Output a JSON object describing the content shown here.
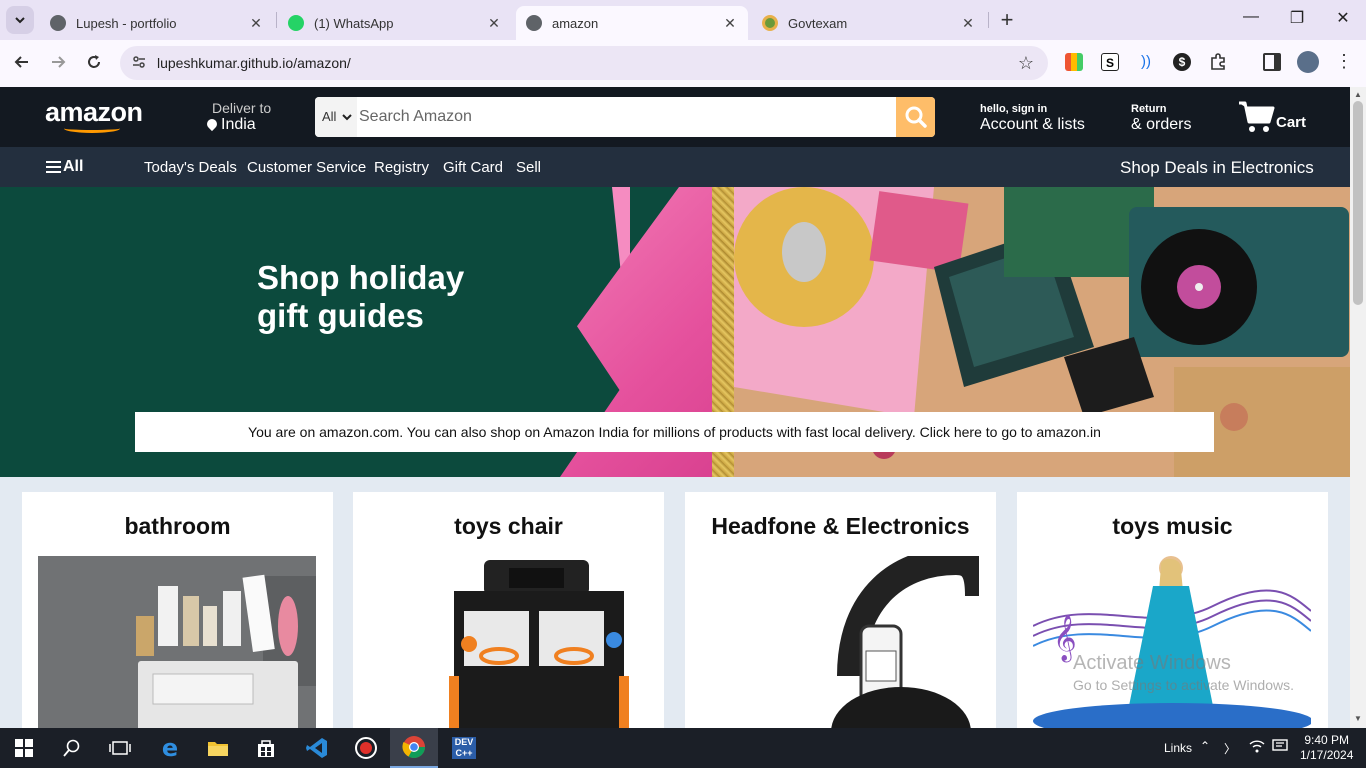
{
  "browser": {
    "tabs": [
      {
        "title": "Lupesh - portfolio",
        "active": false,
        "favicon": "globe-icon"
      },
      {
        "title": "(1) WhatsApp",
        "active": false,
        "favicon": "whatsapp-icon"
      },
      {
        "title": "amazon",
        "active": true,
        "favicon": "globe-icon"
      },
      {
        "title": "Govtexam",
        "active": false,
        "favicon": "govtexam-icon"
      }
    ],
    "url": "lupeshkumar.github.io/amazon/"
  },
  "header": {
    "logo": "amazon",
    "deliver_to": "Deliver to",
    "location": "India",
    "search_category": "All",
    "search_placeholder": "Search Amazon",
    "account_small": "hello, sign in",
    "account_big": "Account & lists",
    "returns_small": "Return",
    "returns_big": "& orders",
    "cart": "Cart"
  },
  "nav": {
    "all": "All",
    "items": [
      "Today's Deals",
      "Customer Service",
      "Registry",
      "Gift Card",
      "Sell"
    ],
    "right": "Shop Deals in Electronics"
  },
  "hero": {
    "title_line1": "Shop holiday",
    "title_line2": "gift guides",
    "notice": "You are on amazon.com. You can also shop on Amazon India for millions of products with fast local delivery. Click here to go to amazon.in"
  },
  "cards": [
    {
      "title": "bathroom"
    },
    {
      "title": "toys chair"
    },
    {
      "title": "Headfone & Electronics"
    },
    {
      "title": "toys music"
    }
  ],
  "watermark": {
    "line1": "Activate Windows",
    "line2": "Go to Settings to activate Windows."
  },
  "taskbar": {
    "links": "Links",
    "time": "9:40 PM",
    "date": "1/17/2024"
  },
  "colors": {
    "amazon_dark": "#131921",
    "amazon_nav": "#232f3e",
    "amazon_orange": "#febd69",
    "hero_green": "#0c4a3d"
  }
}
